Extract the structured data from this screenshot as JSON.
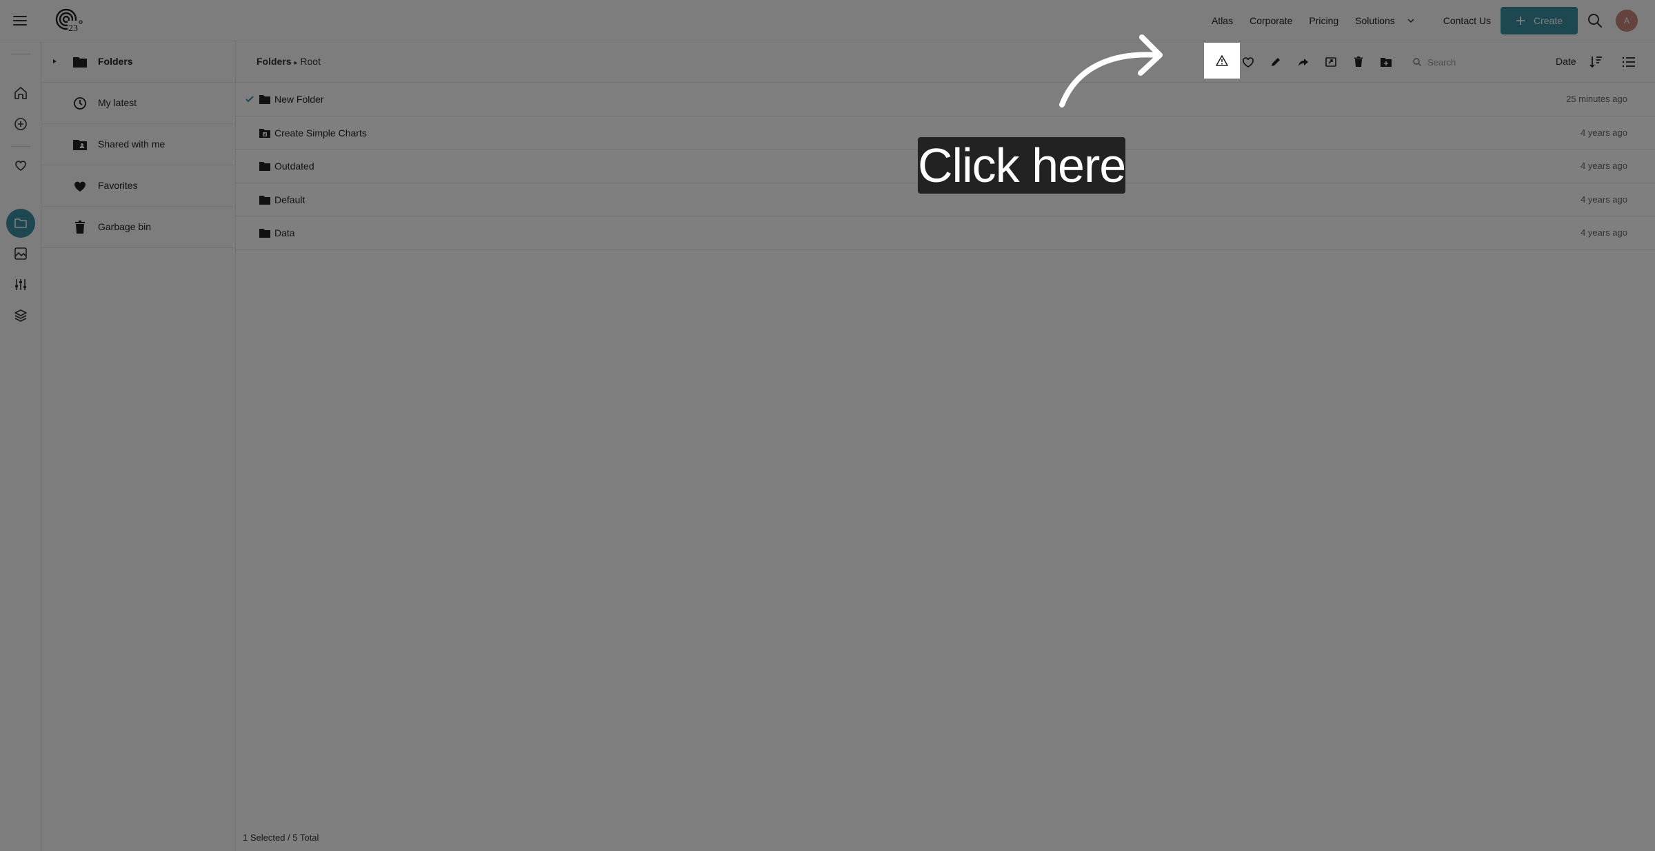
{
  "header": {
    "nav": [
      "Atlas",
      "Corporate",
      "Pricing"
    ],
    "solutions_label": "Solutions",
    "contact_label": "Contact Us",
    "create_label": "Create",
    "avatar_initial": "A"
  },
  "tree": {
    "items": [
      {
        "label": "Folders",
        "icon": "folder-icon"
      },
      {
        "label": "My latest",
        "icon": "clock-icon"
      },
      {
        "label": "Shared with me",
        "icon": "shared-folder-icon"
      },
      {
        "label": "Favorites",
        "icon": "heart-icon"
      },
      {
        "label": "Garbage bin",
        "icon": "trash-icon"
      }
    ]
  },
  "breadcrumb": {
    "root": "Folders",
    "separator": "▸",
    "current": "Root"
  },
  "toolbar": {
    "search_placeholder": "Search",
    "sort_label": "Date"
  },
  "files": [
    {
      "name": "New Folder",
      "date": "25 minutes ago",
      "selected": true,
      "icon": "folder-icon"
    },
    {
      "name": "Create Simple Charts",
      "date": "4 years ago",
      "selected": false,
      "icon": "chart-folder-icon"
    },
    {
      "name": "Outdated",
      "date": "4 years ago",
      "selected": false,
      "icon": "folder-icon"
    },
    {
      "name": "Default",
      "date": "4 years ago",
      "selected": false,
      "icon": "folder-icon"
    },
    {
      "name": "Data",
      "date": "4 years ago",
      "selected": false,
      "icon": "folder-icon"
    }
  ],
  "status": {
    "summary": "1 Selected / 5 Total"
  },
  "overlay": {
    "hint": "Click here"
  },
  "colors": {
    "accent": "#3b8fa3",
    "overlay": "#222222"
  }
}
